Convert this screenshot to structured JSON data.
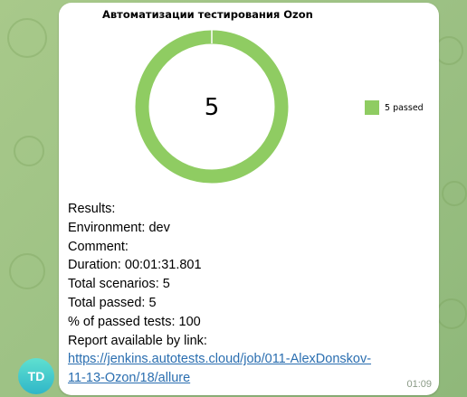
{
  "message": {
    "timestamp": "01:09",
    "avatar_initials": "TD"
  },
  "chart_data": {
    "type": "pie",
    "title": "Автоматизации тестирования Ozon",
    "center_label": "5",
    "categories": [
      "5 passed"
    ],
    "values": [
      5
    ],
    "colors": [
      "#8fcc62"
    ],
    "legend_position": "right"
  },
  "report": {
    "results_label": "Results:",
    "environment_label": "Environment:",
    "environment_value": "dev",
    "comment_label": "Comment:",
    "duration_label": "Duration:",
    "duration_value": "00:01:31.801",
    "total_scenarios_label": "Total scenarios:",
    "total_scenarios_value": "5",
    "total_passed_label": "Total passed:",
    "total_passed_value": "5",
    "percent_label": "% of passed tests:",
    "percent_value": "100",
    "report_link_label": "Report available by link:",
    "link_line1": "https://jenkins.autotests.cloud/job/011-AlexDonskov-",
    "link_line2": "11-13-Ozon/18/allure"
  }
}
